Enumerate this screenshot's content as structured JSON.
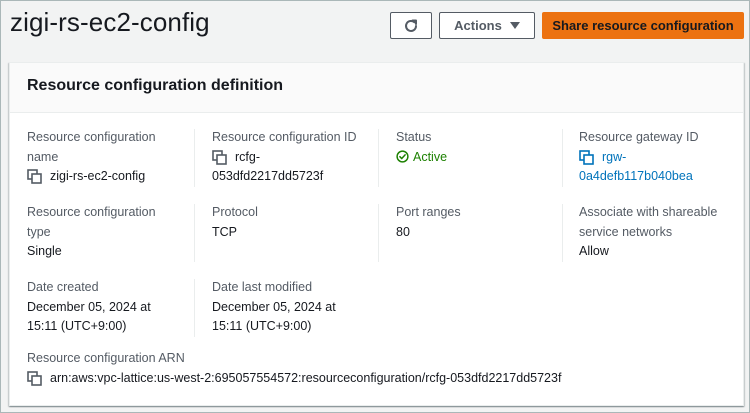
{
  "header": {
    "title": "zigi-rs-ec2-config",
    "actions_label": "Actions",
    "share_label": "Share resource configuration",
    "colors": {
      "primary": "#ec7211",
      "link": "#0073bb",
      "success": "#1d8102"
    }
  },
  "panel": {
    "title": "Resource configuration definition",
    "name": {
      "label_1": "Resource configuration",
      "label_2": "name",
      "value": "zigi-rs-ec2-config"
    },
    "id": {
      "label": "Resource configuration ID",
      "value_1": "rcfg-",
      "value_2": "053dfd2217dd5723f"
    },
    "status": {
      "label": "Status",
      "value": "Active",
      "icon": "check-circle-icon"
    },
    "gateway": {
      "label": "Resource gateway ID",
      "value_1": "rgw-",
      "value_2": "0a4defb117b040bea"
    },
    "type": {
      "label_1": "Resource configuration",
      "label_2": "type",
      "value": "Single"
    },
    "protocol": {
      "label": "Protocol",
      "value": "TCP"
    },
    "ports": {
      "label": "Port ranges",
      "value": "80"
    },
    "shareable": {
      "label_1": "Associate with shareable",
      "label_2": "service networks",
      "value": "Allow"
    },
    "created": {
      "label": "Date created",
      "value_1": "December 05, 2024 at",
      "value_2": "15:11 (UTC+9:00)"
    },
    "modified": {
      "label": "Date last modified",
      "value_1": "December 05, 2024 at",
      "value_2": "15:11 (UTC+9:00)"
    },
    "arn": {
      "label": "Resource configuration ARN",
      "value": "arn:aws:vpc-lattice:us-west-2:695057554572:resourceconfiguration/rcfg-053dfd2217dd5723f"
    }
  }
}
